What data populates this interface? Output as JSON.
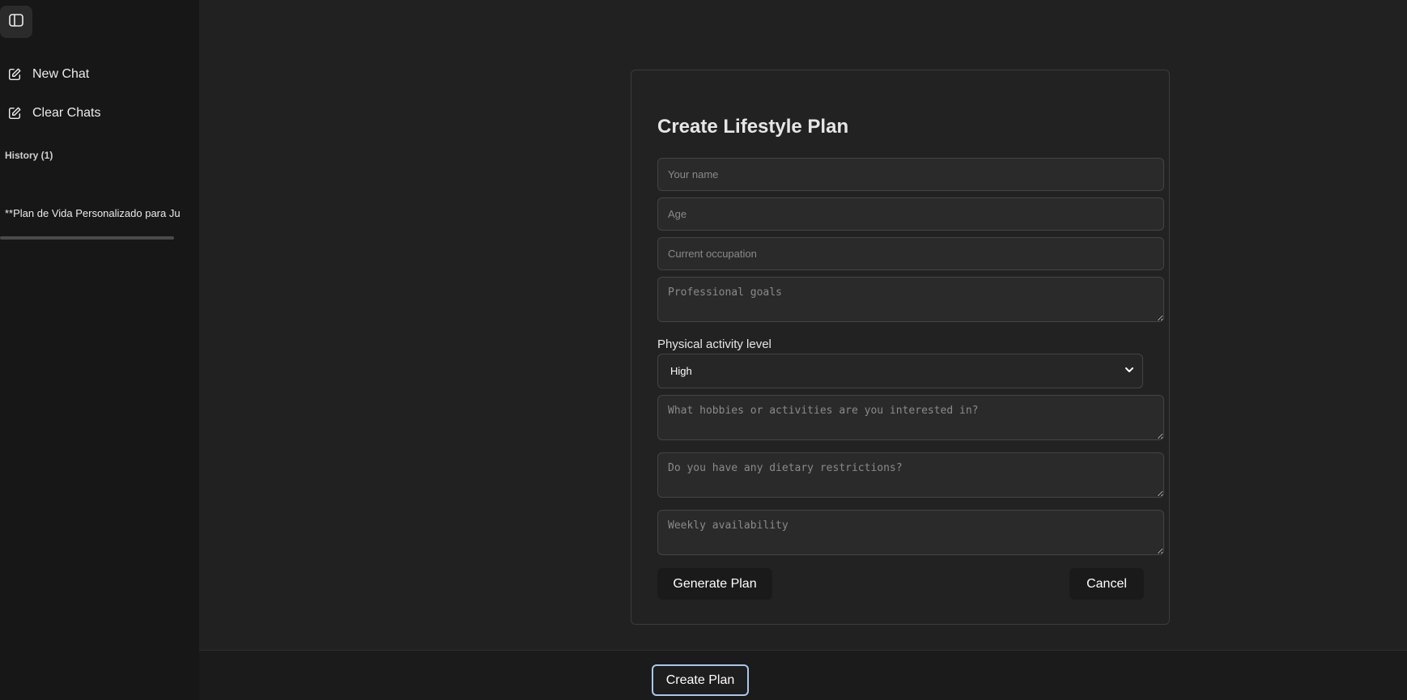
{
  "sidebar": {
    "toggle_icon": "sidebar-panel-icon",
    "items": [
      {
        "label": "New Chat",
        "icon": "pencil-square-icon"
      },
      {
        "label": "Clear Chats",
        "icon": "pencil-square-icon"
      }
    ],
    "history_label": "History (1)",
    "history_items": [
      {
        "title": "**Plan de Vida Personalizado para Ju"
      }
    ]
  },
  "modal": {
    "title": "Create Lifestyle Plan",
    "fields": {
      "name_placeholder": "Your name",
      "age_placeholder": "Age",
      "occupation_placeholder": "Current occupation",
      "goals_placeholder": "Professional goals",
      "hobbies_placeholder": "What hobbies or activities are you interested in?",
      "dietary_placeholder": "Do you have any dietary restrictions?",
      "availability_placeholder": "Weekly availability"
    },
    "activity": {
      "label": "Physical activity level",
      "selected": "High",
      "icon": "chevron-down-icon"
    },
    "generate_label": "Generate Plan",
    "cancel_label": "Cancel"
  },
  "footer": {
    "create_plan_label": "Create Plan"
  },
  "colors": {
    "sidebar_bg": "#171717",
    "main_bg": "#212121",
    "accent_border": "#a8c8ea"
  }
}
